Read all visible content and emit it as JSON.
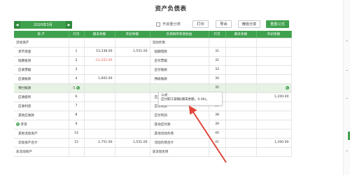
{
  "page": {
    "title": "资产负债表"
  },
  "toolbar": {
    "period": "2020年3月",
    "prev_arrow": "◀",
    "next_arrow": "▶",
    "checkbox_label": "开启重分类",
    "print": "打印",
    "export": "导出",
    "share": "微信分享",
    "reset_formula": "重置公式"
  },
  "table": {
    "headers": [
      "资 产",
      "行次",
      "期末余额",
      "年初余额",
      "负债和所有者权益",
      "行次",
      "期末余额",
      "年初余额"
    ],
    "rows": [
      {
        "a": "流动资产",
        "an": "",
        "ae": "",
        "ab": "",
        "l": "流动负债",
        "ln": "",
        "le": "",
        "lb": ""
      },
      {
        "a": "货币资金",
        "an": "1",
        "ae": "53,338.00",
        "ab": "1,551.00",
        "l": "短期借款",
        "ln": "31",
        "le": "",
        "lb": ""
      },
      {
        "a": "短期投资",
        "an": "2",
        "ae": "-12,252.00",
        "ab": "",
        "l": "应付票据",
        "ln": "32",
        "le": "",
        "lb": ""
      },
      {
        "a": "应收票据",
        "an": "3",
        "ae": "",
        "ab": "",
        "l": "应付账款",
        "ln": "33",
        "le": "",
        "lb": ""
      },
      {
        "a": "应收账款",
        "an": "4",
        "ae": "1,665.00",
        "ab": "",
        "l": "预收账款",
        "ln": "34",
        "le": "",
        "lb": ""
      },
      {
        "a": "预付账款",
        "an": "5",
        "ae": "",
        "ab": "",
        "l": "",
        "ln": "35",
        "le": "",
        "lb": ""
      },
      {
        "a": "应收股利",
        "an": "6",
        "ae": "",
        "ab": "",
        "l": "应交税费",
        "ln": "36",
        "le": "",
        "lb": "1,200.00"
      },
      {
        "a": "应收利息",
        "an": "7",
        "ae": "",
        "ab": "",
        "l": "应付利息",
        "ln": "37",
        "le": "",
        "lb": ""
      },
      {
        "a": "其他应收款",
        "an": "8",
        "ae": "",
        "ab": "",
        "l": "应付利润",
        "ln": "38",
        "le": "",
        "lb": ""
      },
      {
        "a": "存货",
        "an": "9",
        "ae": "",
        "ab": "",
        "l": "其他应付款",
        "ln": "39",
        "le": "",
        "lb": ""
      },
      {
        "a": "其他流动资产",
        "an": "14",
        "ae": "",
        "ab": "",
        "l": "其他流动负债",
        "ln": "40",
        "le": "",
        "lb": ""
      },
      {
        "a": "流动资产合计",
        "an": "15",
        "ae": "2,751.00",
        "ab": "1,551.00",
        "l": "流动负债合计",
        "ln": "41",
        "le": "",
        "lb": "1,200.00"
      },
      {
        "a": "非流动资产",
        "an": "",
        "ae": "",
        "ab": "",
        "l": "非流动负债",
        "ln": "",
        "le": "",
        "lb": ""
      }
    ]
  },
  "tooltip": {
    "line1": "公式:",
    "line2": "应付职工薪酬(期末余额，0.00)。"
  },
  "colors": {
    "accent": "#3fa14e",
    "highlight_row": "#e6f2e3",
    "negative": "#e05a4f",
    "arrow": "#e0453a"
  }
}
